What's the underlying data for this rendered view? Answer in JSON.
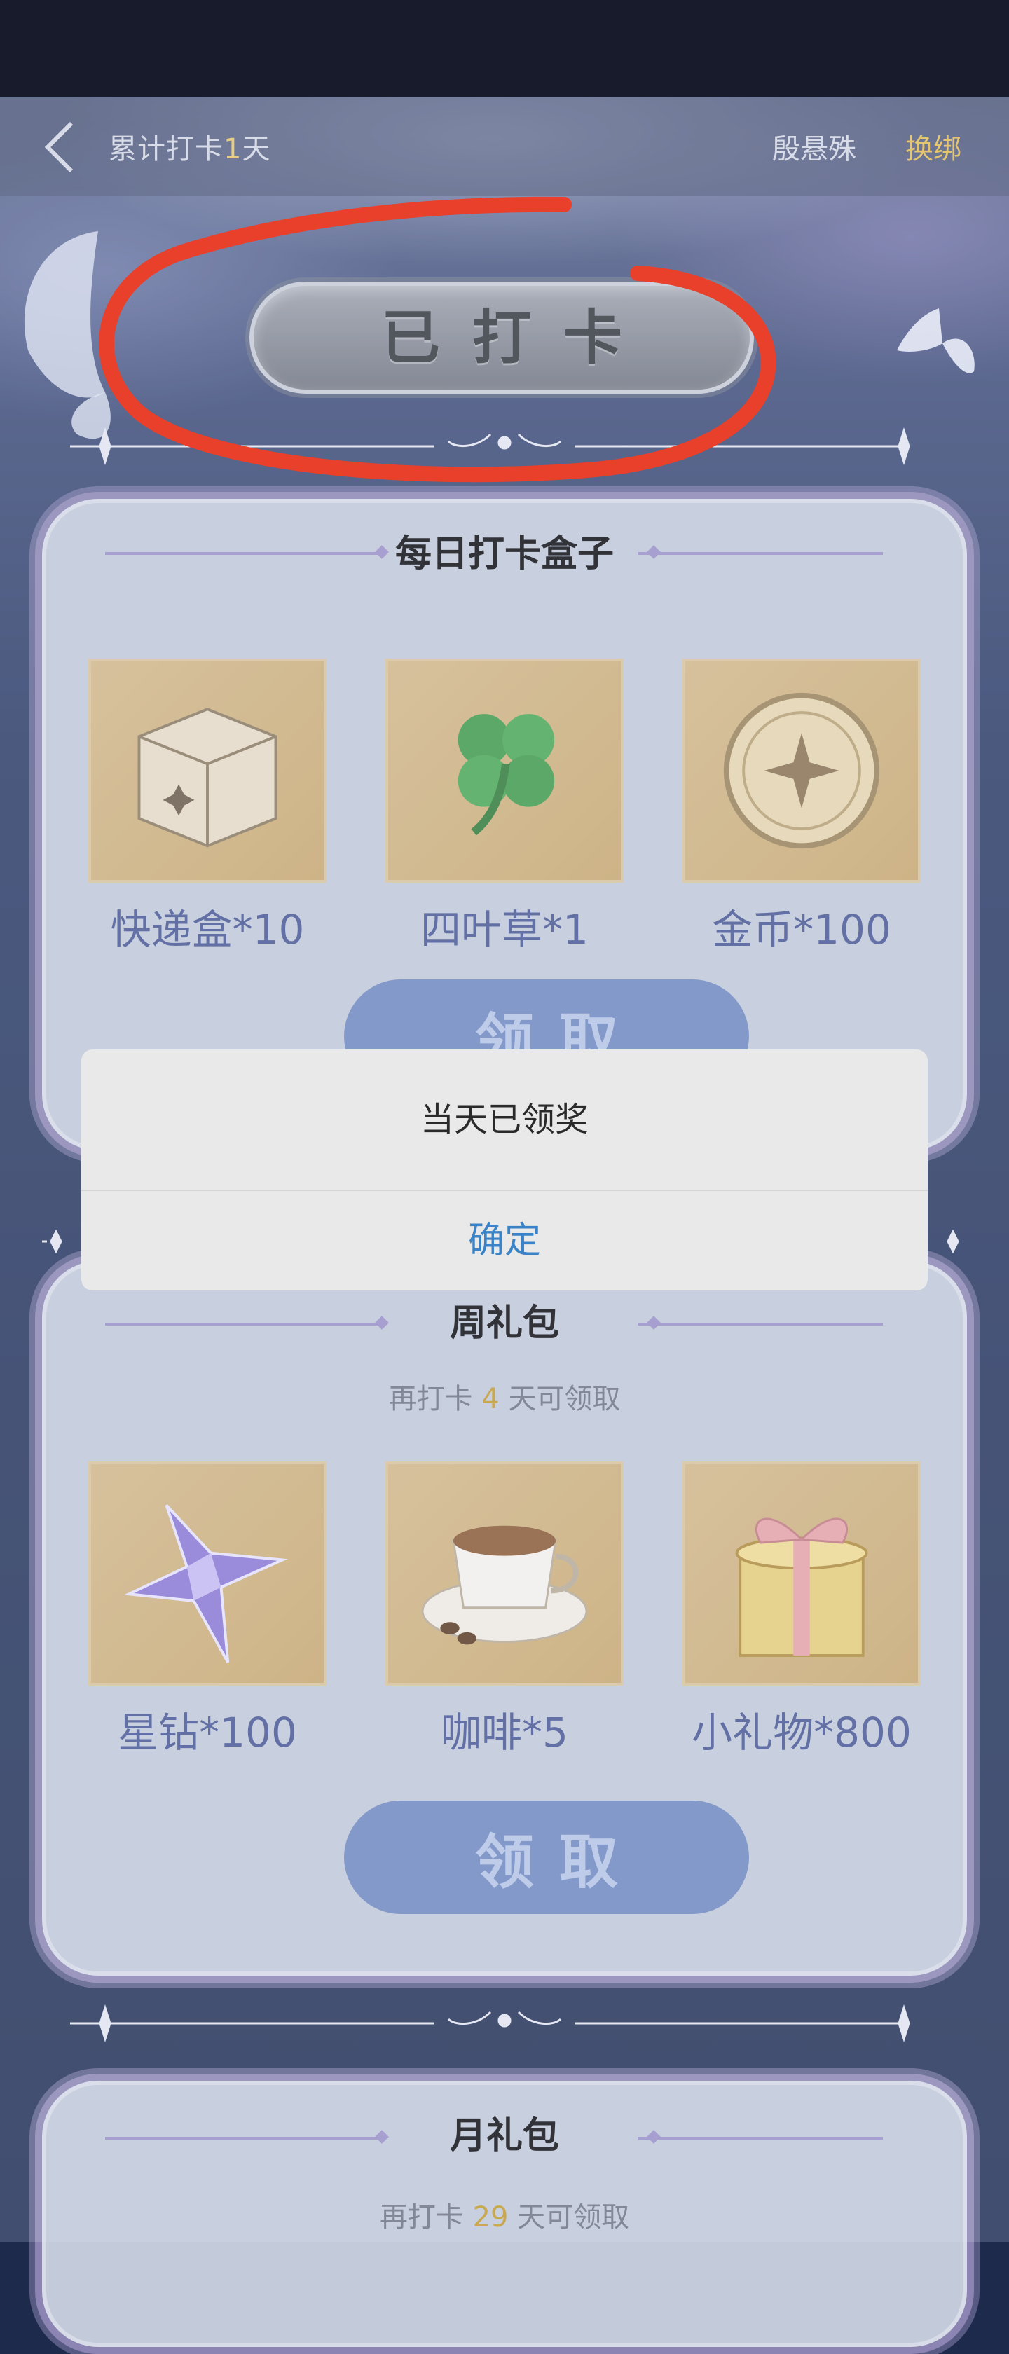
{
  "nav": {
    "title_prefix": "累计打卡",
    "title_count": "1",
    "title_suffix": "天",
    "user_name": "殷悬殊",
    "rebind_label": "换绑"
  },
  "status": {
    "label": "已打卡"
  },
  "daily_box": {
    "title": "每日打卡盒子",
    "rewards": [
      {
        "icon": "parcel-box-icon",
        "label": "快递盒*10"
      },
      {
        "icon": "four-leaf-clover-icon",
        "label": "四叶草*1"
      },
      {
        "icon": "gold-coin-icon",
        "label": "金币*100"
      }
    ],
    "claim_label": "领取"
  },
  "weekly_pack": {
    "title": "周礼包",
    "subtitle_prefix": "再打卡",
    "days_left": "4",
    "subtitle_suffix": "天可领取",
    "rewards": [
      {
        "icon": "star-diamond-icon",
        "label": "星钻*100"
      },
      {
        "icon": "coffee-cup-icon",
        "label": "咖啡*5"
      },
      {
        "icon": "gift-box-icon",
        "label": "小礼物*800"
      }
    ],
    "claim_label": "领取"
  },
  "monthly_pack": {
    "title": "月礼包",
    "subtitle_prefix": "再打卡",
    "days_left": "29",
    "subtitle_suffix": "天可领取"
  },
  "dialog": {
    "message": "当天已领奖",
    "confirm_label": "确定"
  },
  "colors": {
    "highlight_gold": "#e4bf55",
    "reward_label_blue": "#475694",
    "dialog_confirm_blue": "#3a83c8",
    "annotation_red": "#e8402a"
  }
}
